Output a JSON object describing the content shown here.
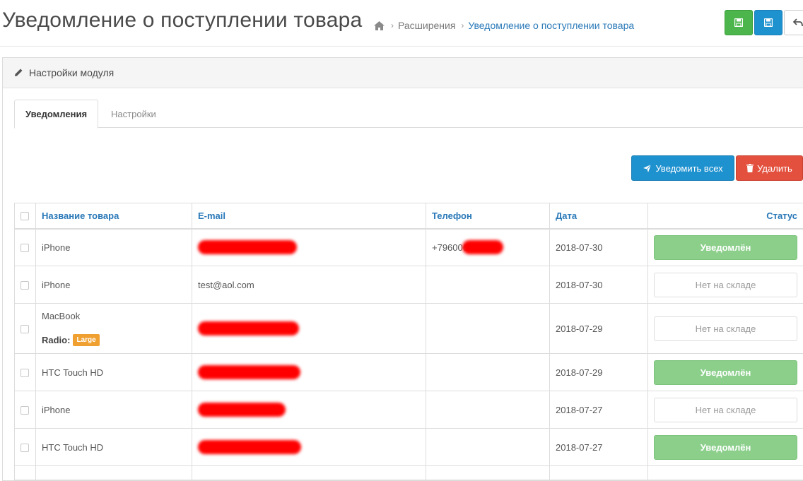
{
  "header": {
    "title": "Уведомление о поступлении товара",
    "breadcrumb": [
      "Расширения",
      "Уведомление о поступлении товара"
    ]
  },
  "panel": {
    "heading": "Настройки модуля"
  },
  "tabs": [
    {
      "label": "Уведомления",
      "active": true
    },
    {
      "label": "Настройки",
      "active": false
    }
  ],
  "actions": {
    "notify_all": "Уведомить всех",
    "delete": "Удалить"
  },
  "table": {
    "columns": [
      "Название товара",
      "E-mail",
      "Телефон",
      "Дата",
      "Статус"
    ],
    "rows": [
      {
        "product": "iPhone",
        "email": "",
        "email_redacted": true,
        "phone": "+796006",
        "phone_redacted": true,
        "date": "2018-07-30",
        "status": "Уведомлён",
        "notified": true
      },
      {
        "product": "iPhone",
        "email": "test@aol.com",
        "email_redacted": false,
        "phone": "",
        "phone_redacted": false,
        "date": "2018-07-30",
        "status": "Нет на складе",
        "notified": false
      },
      {
        "product": "MacBook",
        "option_name": "Radio:",
        "option_value": "Large",
        "email": "",
        "email_redacted": true,
        "phone": "",
        "phone_redacted": false,
        "date": "2018-07-29",
        "status": "Нет на складе",
        "notified": false
      },
      {
        "product": "HTC Touch HD",
        "email": "",
        "email_redacted": true,
        "phone": "",
        "phone_redacted": false,
        "date": "2018-07-29",
        "status": "Уведомлён",
        "notified": true
      },
      {
        "product": "iPhone",
        "email": "",
        "email_redacted": true,
        "phone": "",
        "phone_redacted": false,
        "date": "2018-07-27",
        "status": "Нет на складе",
        "notified": false
      },
      {
        "product": "HTC Touch HD",
        "email": "",
        "email_redacted": true,
        "phone": "",
        "phone_redacted": false,
        "date": "2018-07-27",
        "status": "Уведомлён",
        "notified": true
      }
    ]
  },
  "colors": {
    "primary": "#1e91cf",
    "success": "#4cb64c",
    "danger": "#e3503e",
    "notified": "#8bcf8b",
    "badge": "#f0a030",
    "link": "#2a79b8"
  },
  "icons": [
    "home-icon",
    "save-icon",
    "back-icon",
    "pencil-icon",
    "paper-plane-icon",
    "trash-icon"
  ]
}
